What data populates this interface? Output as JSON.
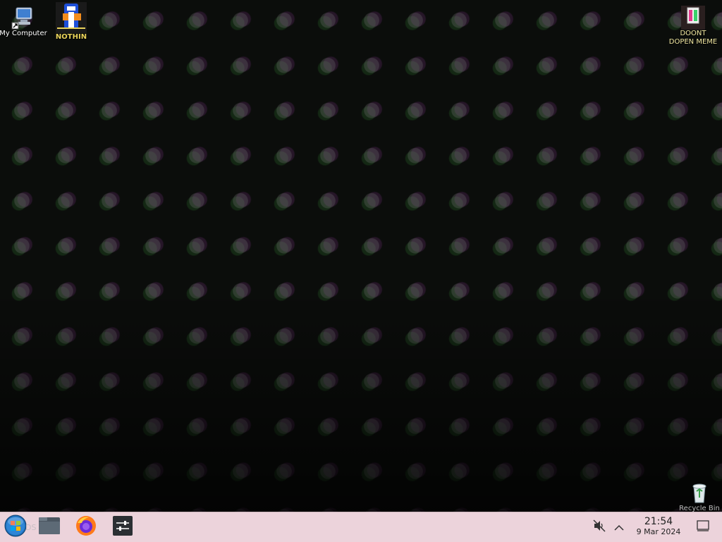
{
  "desktop": {
    "wallpaper": "glitched skulls wallpaper",
    "icons": [
      {
        "label": "My Computer",
        "icon": "computer-icon"
      },
      {
        "label": "NOTHIN",
        "icon": "nothin-app-icon"
      },
      {
        "label": "DOONT DOPEN MEME",
        "icon": "document-icon"
      },
      {
        "label": "Recycle Bin",
        "icon": "recycle-bin-icon"
      }
    ]
  },
  "taskbar": {
    "start_ghost_text": "DS",
    "apps": [
      {
        "name": "Start",
        "icon": "windows-orb-icon"
      },
      {
        "name": "File Manager",
        "icon": "folder-icon"
      },
      {
        "name": "Firefox",
        "icon": "firefox-icon"
      },
      {
        "name": "Mixer",
        "icon": "mixer-icon"
      }
    ],
    "tray": {
      "volume_icon": "volume-muted-icon",
      "expand_icon": "chevron-up-icon",
      "time": "21:54",
      "date": "9 Mar 2024",
      "show_desktop_icon": "show-desktop-icon"
    }
  },
  "colors": {
    "taskbar": "#ecd3db",
    "wallpaper": "#0b0d0b"
  }
}
